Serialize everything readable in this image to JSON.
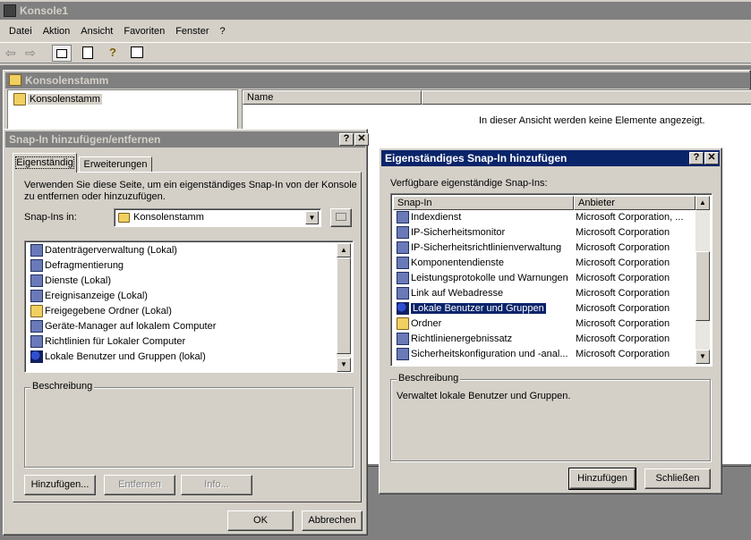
{
  "main_window": {
    "title": "Konsole1",
    "menu": [
      "Datei",
      "Aktion",
      "Ansicht",
      "Favoriten",
      "Fenster",
      "?"
    ],
    "inner_title": "Konsolenstamm",
    "tree_root": "Konsolenstamm",
    "name_column": "Name",
    "empty_message": "In dieser Ansicht werden keine Elemente angezeigt."
  },
  "snapin_dialog": {
    "title": "Snap-In hinzufügen/entfernen",
    "tabs": [
      "Eigenständig",
      "Erweiterungen"
    ],
    "description_text": "Verwenden Sie diese Seite, um ein eigenständiges Snap-In von der Konsole zu entfernen oder hinzuzufügen.",
    "snapins_in_label": "Snap-Ins in:",
    "snapins_in_value": "Konsolenstamm",
    "items": [
      "Datenträgerverwaltung (Lokal)",
      "Defragmentierung",
      "Dienste (Lokal)",
      "Ereignisanzeige (Lokal)",
      "Freigegebene Ordner (Lokal)",
      "Geräte-Manager auf lokalem Computer",
      "Richtlinien für Lokaler Computer",
      "Lokale Benutzer und Gruppen (lokal)"
    ],
    "beschreibung_label": "Beschreibung",
    "buttons": {
      "add": "Hinzufügen...",
      "remove": "Entfernen",
      "info": "Info..."
    },
    "ok": "OK",
    "cancel": "Abbrechen"
  },
  "standalone_dialog": {
    "title": "Eigenständiges Snap-In hinzufügen",
    "available_label": "Verfügbare eigenständige Snap-Ins:",
    "col_snapin": "Snap-In",
    "col_vendor": "Anbieter",
    "rows": [
      {
        "name": "Indexdienst",
        "vendor": "Microsoft Corporation, ..."
      },
      {
        "name": "IP-Sicherheitsmonitor",
        "vendor": "Microsoft Corporation"
      },
      {
        "name": "IP-Sicherheitsrichtlinienverwaltung",
        "vendor": "Microsoft Corporation"
      },
      {
        "name": "Komponentendienste",
        "vendor": "Microsoft Corporation"
      },
      {
        "name": "Leistungsprotokolle und Warnungen",
        "vendor": "Microsoft Corporation"
      },
      {
        "name": "Link auf Webadresse",
        "vendor": "Microsoft Corporation"
      },
      {
        "name": "Lokale Benutzer und Gruppen",
        "vendor": "Microsoft Corporation"
      },
      {
        "name": "Ordner",
        "vendor": "Microsoft Corporation"
      },
      {
        "name": "Richtlinienergebnissatz",
        "vendor": "Microsoft Corporation"
      },
      {
        "name": "Sicherheitskonfiguration und -anal...",
        "vendor": "Microsoft Corporation"
      }
    ],
    "selected_row": "Lokale Benutzer und Gruppen",
    "beschreibung_label": "Beschreibung",
    "beschreibung_text": "Verwaltet lokale Benutzer und Gruppen.",
    "add": "Hinzufügen",
    "close": "Schließen"
  },
  "colors": {
    "active_title": "#0a246a",
    "inactive_title": "#808080",
    "face": "#d4d0c8"
  }
}
